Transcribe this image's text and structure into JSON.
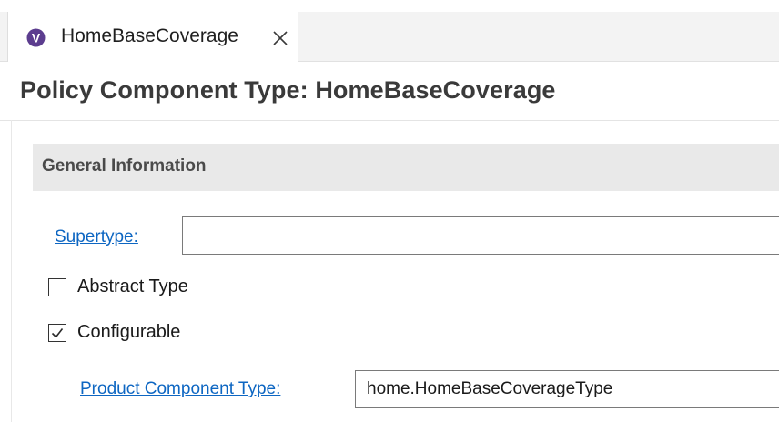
{
  "tab": {
    "label": "HomeBaseCoverage",
    "icon": "v-circle-icon",
    "icon_letter": "V",
    "icon_color": "#5c3d8f",
    "close_icon": "close-icon"
  },
  "header": {
    "title": "Policy Component Type: HomeBaseCoverage"
  },
  "section": {
    "title": "General Information"
  },
  "form": {
    "supertype_label": "Supertype:",
    "supertype_value": "",
    "abstract_label": "Abstract Type",
    "abstract_checked": false,
    "configurable_label": "Configurable",
    "configurable_checked": true,
    "product_component_label": "Product Component Type:",
    "product_component_value": "home.HomeBaseCoverageType"
  },
  "colors": {
    "link": "#0d66c2",
    "section_bg": "#e9e9e9",
    "title_text": "#3a3a3a"
  }
}
